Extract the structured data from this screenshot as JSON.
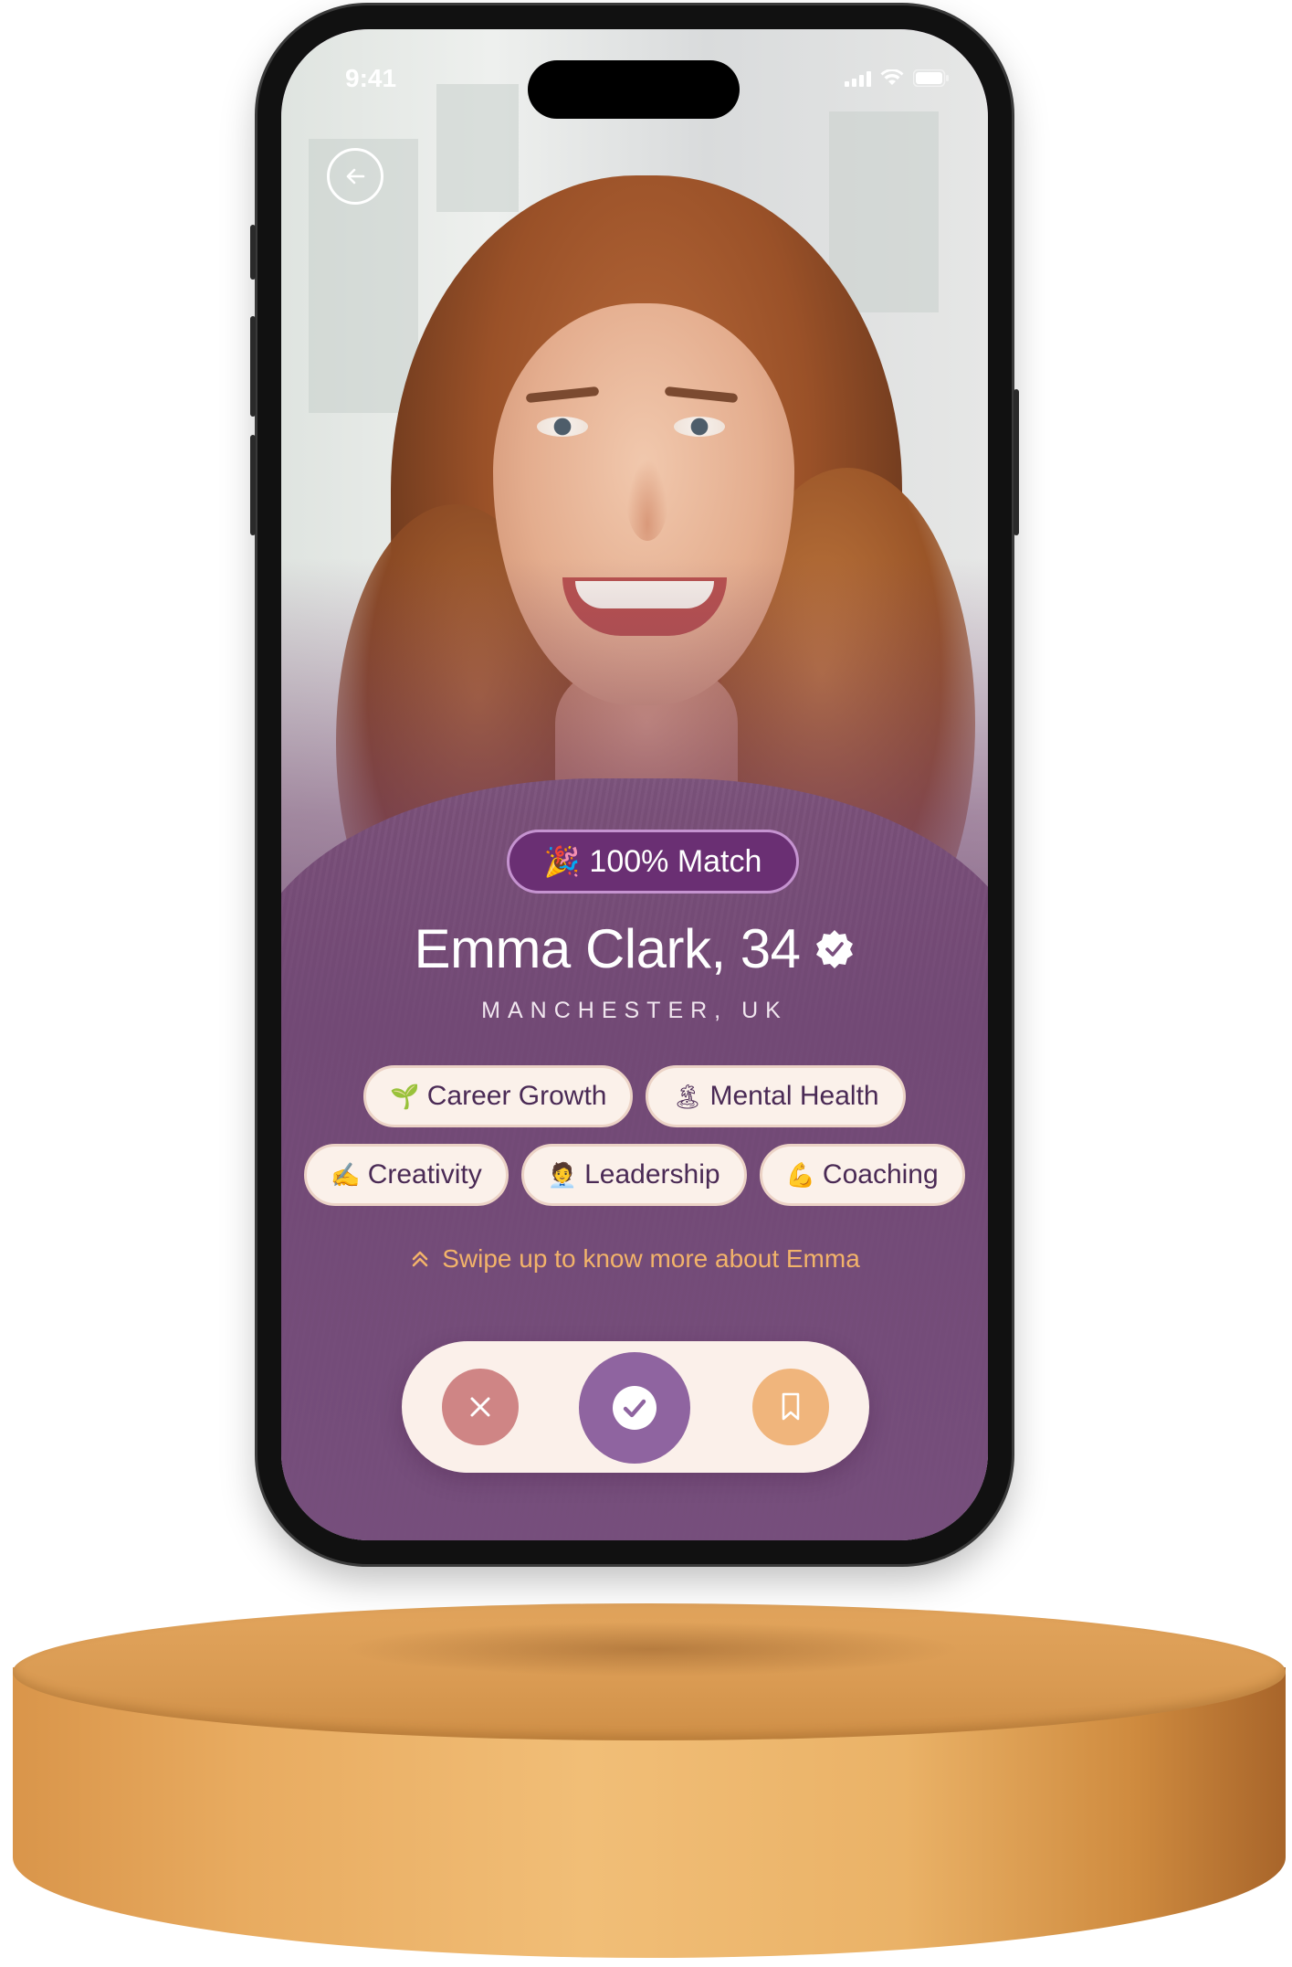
{
  "status_bar": {
    "time": "9:41"
  },
  "profile": {
    "match_label": "100% Match",
    "name": "Emma Clark, 34",
    "location": "MANCHESTER, UK"
  },
  "tags": {
    "row1": [
      {
        "emoji": "🌱",
        "label": "Career Growth"
      },
      {
        "emoji": "🏝",
        "label": "Mental Health"
      }
    ],
    "row2": [
      {
        "emoji": "✍",
        "label": "Creativity"
      },
      {
        "emoji": "🧑‍💼",
        "label": "Leadership"
      },
      {
        "emoji": "💪",
        "label": "Coaching"
      }
    ]
  },
  "swipe_hint": "Swipe up to know more about Emma",
  "icons": {
    "back": "arrow-left-icon",
    "verified": "verified-badge-icon",
    "match": "party-popper-icon",
    "swipe": "double-chevron-up-icon",
    "reject": "close-icon",
    "accept": "check-icon",
    "save": "bookmark-icon"
  },
  "colors": {
    "brand_purple": "#6a2f73",
    "accent_orange": "#f2b36a",
    "reject": "#cf8585",
    "accept": "#8f64a0",
    "save": "#f0b57c",
    "tag_bg": "#fbf1ea"
  }
}
